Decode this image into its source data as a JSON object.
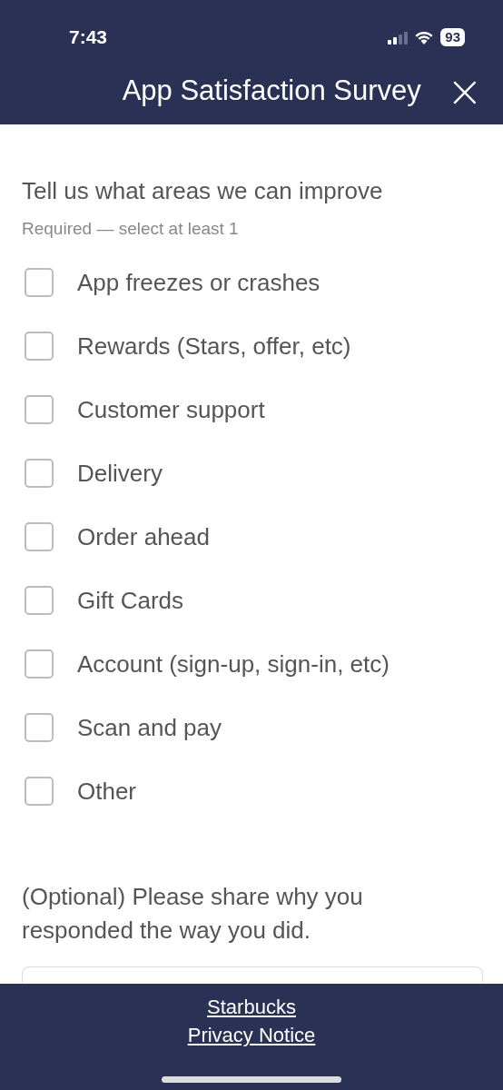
{
  "status_bar": {
    "time": "7:43",
    "battery": "93"
  },
  "header": {
    "title": "App Satisfaction Survey",
    "close": "×"
  },
  "question": {
    "title": "Tell us what areas we can improve",
    "hint": "Required — select at least 1",
    "options": [
      {
        "label": "App freezes or crashes",
        "checked": false
      },
      {
        "label": "Rewards (Stars, offer, etc)",
        "checked": false
      },
      {
        "label": "Customer support",
        "checked": false
      },
      {
        "label": "Delivery",
        "checked": false
      },
      {
        "label": "Order ahead",
        "checked": false
      },
      {
        "label": "Gift Cards",
        "checked": false
      },
      {
        "label": "Account (sign-up, sign-in, etc)",
        "checked": false
      },
      {
        "label": "Scan and pay",
        "checked": false
      },
      {
        "label": "Other",
        "checked": false
      }
    ]
  },
  "feedback": {
    "prompt": "(Optional) Please share why you responded the way you did."
  },
  "footer": {
    "links": [
      "Starbucks",
      "Privacy Notice"
    ]
  }
}
